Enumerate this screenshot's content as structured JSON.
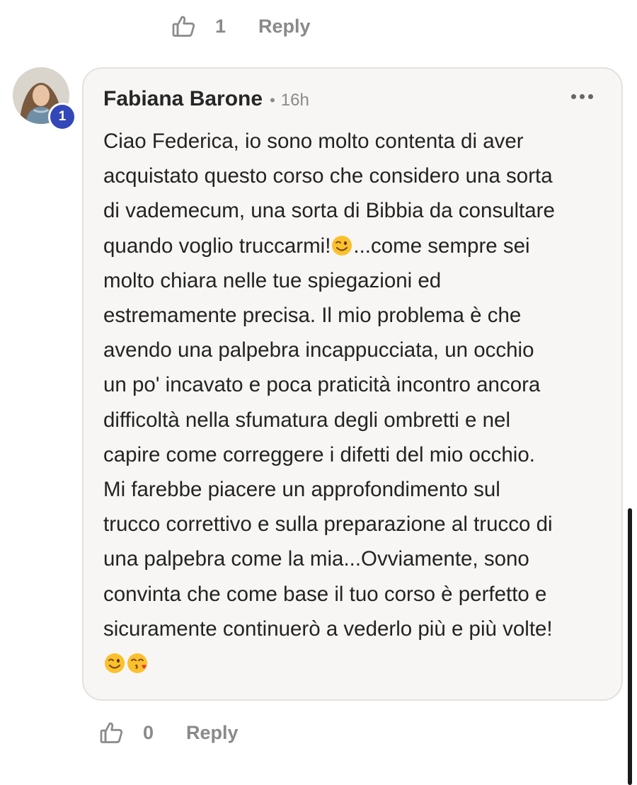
{
  "top_actions": {
    "like_count": "1",
    "reply_label": "Reply"
  },
  "comment": {
    "author": "Fabiana Barone",
    "separator": "•",
    "timestamp": "16h",
    "level_badge": "1",
    "body_parts": [
      "Ciao Federica, io sono molto contenta di aver\nacquistato questo corso che considero una sorta\ndi vademecum, una sorta di Bibbia da consultare\nquando voglio truccarmi!",
      "...come sempre sei\nmolto chiara nelle tue spiegazioni ed\nestremamente precisa. Il mio problema è che\navendo una palpebra incappucciata, un occhio\nun po' incavato e poca praticità incontro ancora\ndifficoltà nella sfumatura degli ombretti e nel\ncapire come correggere i difetti del mio occhio.\nMi farebbe piacere un approfondimento sul\ntrucco correttivo e sulla preparazione al trucco di\nuna palpebra come la mia...Ovviamente, sono\nconvinta che come base il tuo corso è perfetto e\nsicuramente continuerò a vederlo più e più volte!\n"
    ],
    "emojis": [
      "winking-face-emoji",
      "face-blowing-kiss-emoji"
    ]
  },
  "comment_actions": {
    "like_count": "0",
    "reply_label": "Reply"
  },
  "colors": {
    "card_background": "#f7f6f4",
    "card_border": "#e3e1de",
    "badge": "#3447b8",
    "muted_text": "#8a8a8a",
    "emoji_yellow": "#fbc02d"
  }
}
